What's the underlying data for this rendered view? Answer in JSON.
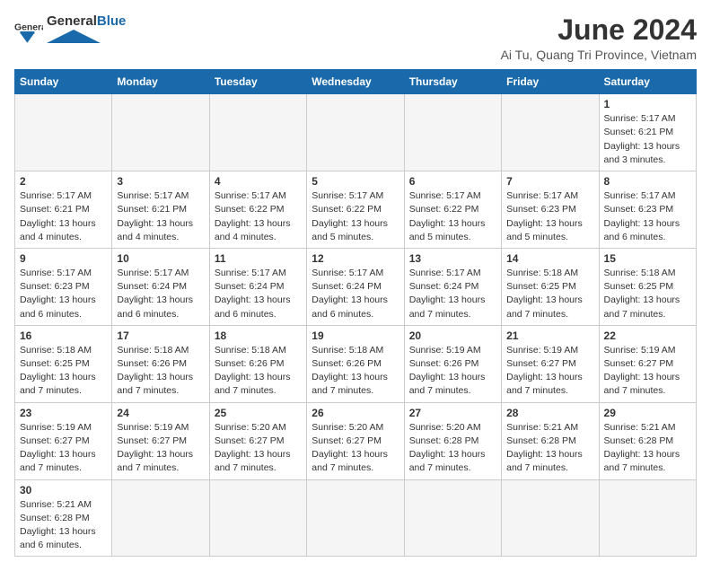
{
  "header": {
    "logo_general": "General",
    "logo_blue": "Blue",
    "title": "June 2024",
    "subtitle": "Ai Tu, Quang Tri Province, Vietnam"
  },
  "days_of_week": [
    "Sunday",
    "Monday",
    "Tuesday",
    "Wednesday",
    "Thursday",
    "Friday",
    "Saturday"
  ],
  "weeks": [
    [
      {
        "day": "",
        "info": ""
      },
      {
        "day": "",
        "info": ""
      },
      {
        "day": "",
        "info": ""
      },
      {
        "day": "",
        "info": ""
      },
      {
        "day": "",
        "info": ""
      },
      {
        "day": "",
        "info": ""
      },
      {
        "day": "1",
        "info": "Sunrise: 5:17 AM\nSunset: 6:21 PM\nDaylight: 13 hours and 3 minutes."
      }
    ],
    [
      {
        "day": "2",
        "info": "Sunrise: 5:17 AM\nSunset: 6:21 PM\nDaylight: 13 hours and 4 minutes."
      },
      {
        "day": "3",
        "info": "Sunrise: 5:17 AM\nSunset: 6:21 PM\nDaylight: 13 hours and 4 minutes."
      },
      {
        "day": "4",
        "info": "Sunrise: 5:17 AM\nSunset: 6:22 PM\nDaylight: 13 hours and 4 minutes."
      },
      {
        "day": "5",
        "info": "Sunrise: 5:17 AM\nSunset: 6:22 PM\nDaylight: 13 hours and 5 minutes."
      },
      {
        "day": "6",
        "info": "Sunrise: 5:17 AM\nSunset: 6:22 PM\nDaylight: 13 hours and 5 minutes."
      },
      {
        "day": "7",
        "info": "Sunrise: 5:17 AM\nSunset: 6:23 PM\nDaylight: 13 hours and 5 minutes."
      },
      {
        "day": "8",
        "info": "Sunrise: 5:17 AM\nSunset: 6:23 PM\nDaylight: 13 hours and 6 minutes."
      }
    ],
    [
      {
        "day": "9",
        "info": "Sunrise: 5:17 AM\nSunset: 6:23 PM\nDaylight: 13 hours and 6 minutes."
      },
      {
        "day": "10",
        "info": "Sunrise: 5:17 AM\nSunset: 6:24 PM\nDaylight: 13 hours and 6 minutes."
      },
      {
        "day": "11",
        "info": "Sunrise: 5:17 AM\nSunset: 6:24 PM\nDaylight: 13 hours and 6 minutes."
      },
      {
        "day": "12",
        "info": "Sunrise: 5:17 AM\nSunset: 6:24 PM\nDaylight: 13 hours and 6 minutes."
      },
      {
        "day": "13",
        "info": "Sunrise: 5:17 AM\nSunset: 6:24 PM\nDaylight: 13 hours and 7 minutes."
      },
      {
        "day": "14",
        "info": "Sunrise: 5:18 AM\nSunset: 6:25 PM\nDaylight: 13 hours and 7 minutes."
      },
      {
        "day": "15",
        "info": "Sunrise: 5:18 AM\nSunset: 6:25 PM\nDaylight: 13 hours and 7 minutes."
      }
    ],
    [
      {
        "day": "16",
        "info": "Sunrise: 5:18 AM\nSunset: 6:25 PM\nDaylight: 13 hours and 7 minutes."
      },
      {
        "day": "17",
        "info": "Sunrise: 5:18 AM\nSunset: 6:26 PM\nDaylight: 13 hours and 7 minutes."
      },
      {
        "day": "18",
        "info": "Sunrise: 5:18 AM\nSunset: 6:26 PM\nDaylight: 13 hours and 7 minutes."
      },
      {
        "day": "19",
        "info": "Sunrise: 5:18 AM\nSunset: 6:26 PM\nDaylight: 13 hours and 7 minutes."
      },
      {
        "day": "20",
        "info": "Sunrise: 5:19 AM\nSunset: 6:26 PM\nDaylight: 13 hours and 7 minutes."
      },
      {
        "day": "21",
        "info": "Sunrise: 5:19 AM\nSunset: 6:27 PM\nDaylight: 13 hours and 7 minutes."
      },
      {
        "day": "22",
        "info": "Sunrise: 5:19 AM\nSunset: 6:27 PM\nDaylight: 13 hours and 7 minutes."
      }
    ],
    [
      {
        "day": "23",
        "info": "Sunrise: 5:19 AM\nSunset: 6:27 PM\nDaylight: 13 hours and 7 minutes."
      },
      {
        "day": "24",
        "info": "Sunrise: 5:19 AM\nSunset: 6:27 PM\nDaylight: 13 hours and 7 minutes."
      },
      {
        "day": "25",
        "info": "Sunrise: 5:20 AM\nSunset: 6:27 PM\nDaylight: 13 hours and 7 minutes."
      },
      {
        "day": "26",
        "info": "Sunrise: 5:20 AM\nSunset: 6:27 PM\nDaylight: 13 hours and 7 minutes."
      },
      {
        "day": "27",
        "info": "Sunrise: 5:20 AM\nSunset: 6:28 PM\nDaylight: 13 hours and 7 minutes."
      },
      {
        "day": "28",
        "info": "Sunrise: 5:21 AM\nSunset: 6:28 PM\nDaylight: 13 hours and 7 minutes."
      },
      {
        "day": "29",
        "info": "Sunrise: 5:21 AM\nSunset: 6:28 PM\nDaylight: 13 hours and 7 minutes."
      }
    ],
    [
      {
        "day": "30",
        "info": "Sunrise: 5:21 AM\nSunset: 6:28 PM\nDaylight: 13 hours and 6 minutes."
      },
      {
        "day": "",
        "info": ""
      },
      {
        "day": "",
        "info": ""
      },
      {
        "day": "",
        "info": ""
      },
      {
        "day": "",
        "info": ""
      },
      {
        "day": "",
        "info": ""
      },
      {
        "day": "",
        "info": ""
      }
    ]
  ]
}
